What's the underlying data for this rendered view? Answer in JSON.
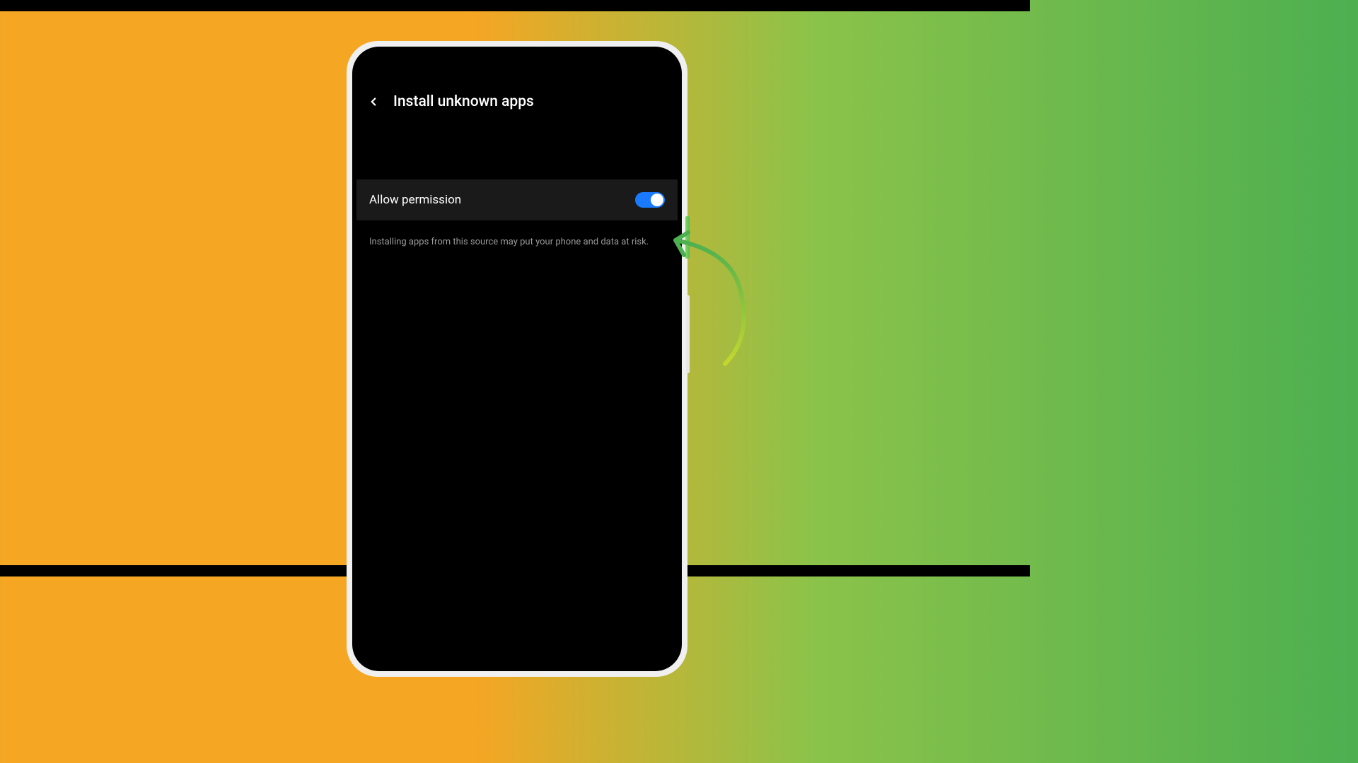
{
  "header": {
    "title": "Install unknown apps"
  },
  "setting": {
    "label": "Allow permission",
    "toggle_state": "on"
  },
  "description": "Installing apps from this source may put your phone and data at risk."
}
